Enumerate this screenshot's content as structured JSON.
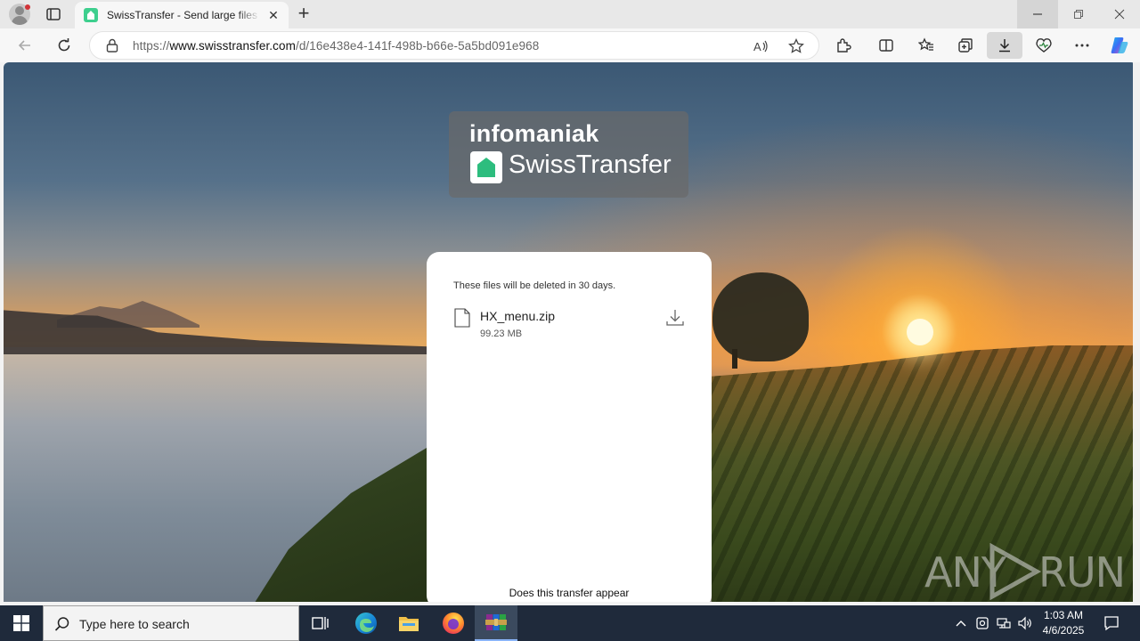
{
  "browser": {
    "tab": {
      "title": "SwissTransfer - Send large files securely",
      "close_glyph": "✕"
    },
    "new_tab_glyph": "+",
    "url_prefix": "https://",
    "url_domain": "www.swisstransfer.com",
    "url_path": "/d/16e438e4-141f-498b-b66e-5a5bd091e968"
  },
  "page": {
    "logo_word": "infomaniak",
    "logo_name": "SwissTransfer",
    "card": {
      "delete_note": "These files will be deleted in 30 days.",
      "file": {
        "name": "HX_menu.zip",
        "size": "99.23 MB"
      },
      "transfer_note": "Does this transfer appear"
    },
    "watermark": {
      "left": "ANY",
      "right": "RUN"
    }
  },
  "taskbar": {
    "search_placeholder": "Type here to search",
    "time": "1:03 AM",
    "date": "4/6/2025"
  },
  "colors": {
    "brand_green": "#2dbd7e",
    "taskbar_bg": "#1f2a3b",
    "card_bg": "#ffffff"
  },
  "icons": {
    "start": "windows-logo-icon",
    "edge": "edge-icon",
    "explorer": "folder-icon",
    "firefox": "firefox-icon",
    "winrar": "winrar-icon"
  }
}
